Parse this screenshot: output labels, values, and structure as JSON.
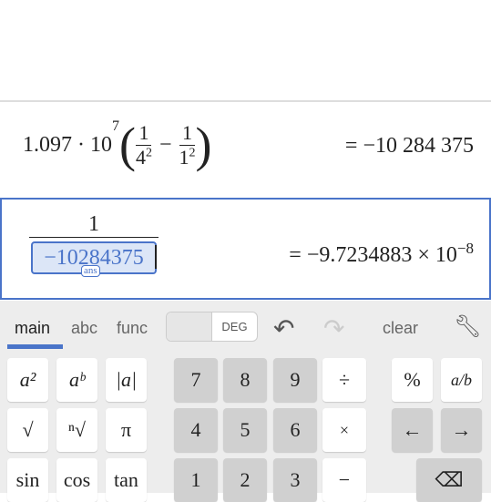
{
  "expressions": [
    {
      "prefix": "1.097 · 10",
      "exp": "7",
      "f1_num": "1",
      "f1_den": "4",
      "f1_den_exp": "2",
      "minus": "−",
      "f2_num": "1",
      "f2_den": "1",
      "f2_den_exp": "2",
      "result": "= −10 284 375"
    },
    {
      "num": "1",
      "den": "−10284375",
      "den_tag": "ans",
      "result": "= −9.7234883 × 10",
      "result_exp": "−8"
    }
  ],
  "keypad": {
    "tabs": [
      "main",
      "abc",
      "func"
    ],
    "active_tab": "main",
    "angle_toggle": "DEG",
    "clear": "clear",
    "accent": "#4a74c9",
    "keys": [
      [
        "a²",
        "aᵇ",
        "|a|",
        "7",
        "8",
        "9",
        "÷",
        "%",
        "a/b"
      ],
      [
        "√",
        "ⁿ√",
        "π",
        "4",
        "5",
        "6",
        "×",
        "←",
        "→"
      ],
      [
        "sin",
        "cos",
        "tan",
        "1",
        "2",
        "3",
        "−",
        "⌫"
      ]
    ]
  }
}
